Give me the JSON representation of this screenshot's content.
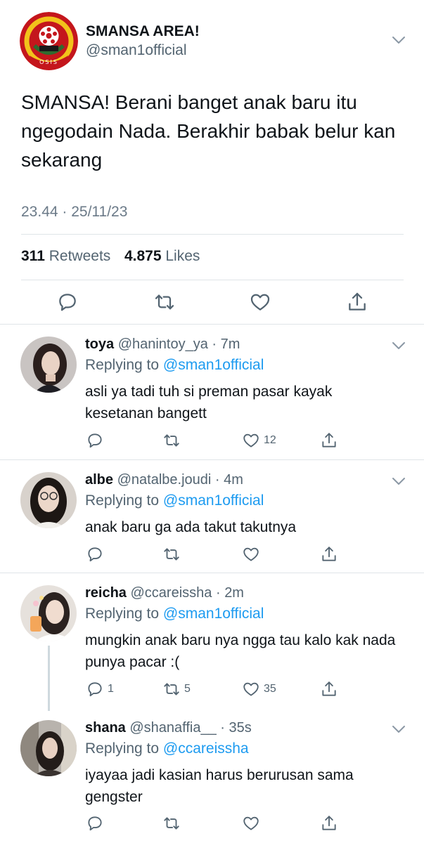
{
  "main_tweet": {
    "author_name": "SMANSA AREA!",
    "author_handle": "@sman1official",
    "logo_text": "OSIS",
    "text": "SMANSA! Berani banget anak baru itu ngegodain Nada. Berakhir babak belur kan sekarang",
    "time": "23.44 · 25/11/23",
    "retweets_count": "311",
    "retweets_label": "Retweets",
    "likes_count": "4.875",
    "likes_label": "Likes",
    "icons": [
      "reply-icon",
      "retweet-icon",
      "like-icon",
      "share-icon"
    ]
  },
  "replies": [
    {
      "name": "toya",
      "handle": "@hanintoy_ya",
      "time": "7m",
      "replying_label": "Replying to",
      "replying_to": "@sman1official",
      "text": "asli ya tadi tuh si preman pasar kayak kesetanan bangett",
      "reply_count": "",
      "retweet_count": "",
      "like_count": "12"
    },
    {
      "name": "albe",
      "handle": "@natalbe.joudi",
      "time": "4m",
      "replying_label": "Replying to",
      "replying_to": "@sman1official",
      "text": "anak baru ga ada takut takutnya",
      "reply_count": "",
      "retweet_count": "",
      "like_count": ""
    },
    {
      "name": "reicha",
      "handle": "@ccareissha",
      "time": "2m",
      "replying_label": "Replying to",
      "replying_to": "@sman1official",
      "text": "mungkin anak baru nya ngga tau kalo kak nada punya pacar :(",
      "reply_count": "1",
      "retweet_count": "5",
      "like_count": "35"
    },
    {
      "name": "shana",
      "handle": "@shanaffia__",
      "time": "35s",
      "replying_label": "Replying to",
      "replying_to": "@ccareissha",
      "text": "iyayaa jadi kasian harus berurusan sama gengster",
      "reply_count": "",
      "retweet_count": "",
      "like_count": ""
    }
  ],
  "colors": {
    "text": "#0f1419",
    "secondary": "#536471",
    "link": "#1d9bf0",
    "divider": "#dfe4e8",
    "logo_red": "#c4161c",
    "logo_yellow": "#f2c21b"
  }
}
